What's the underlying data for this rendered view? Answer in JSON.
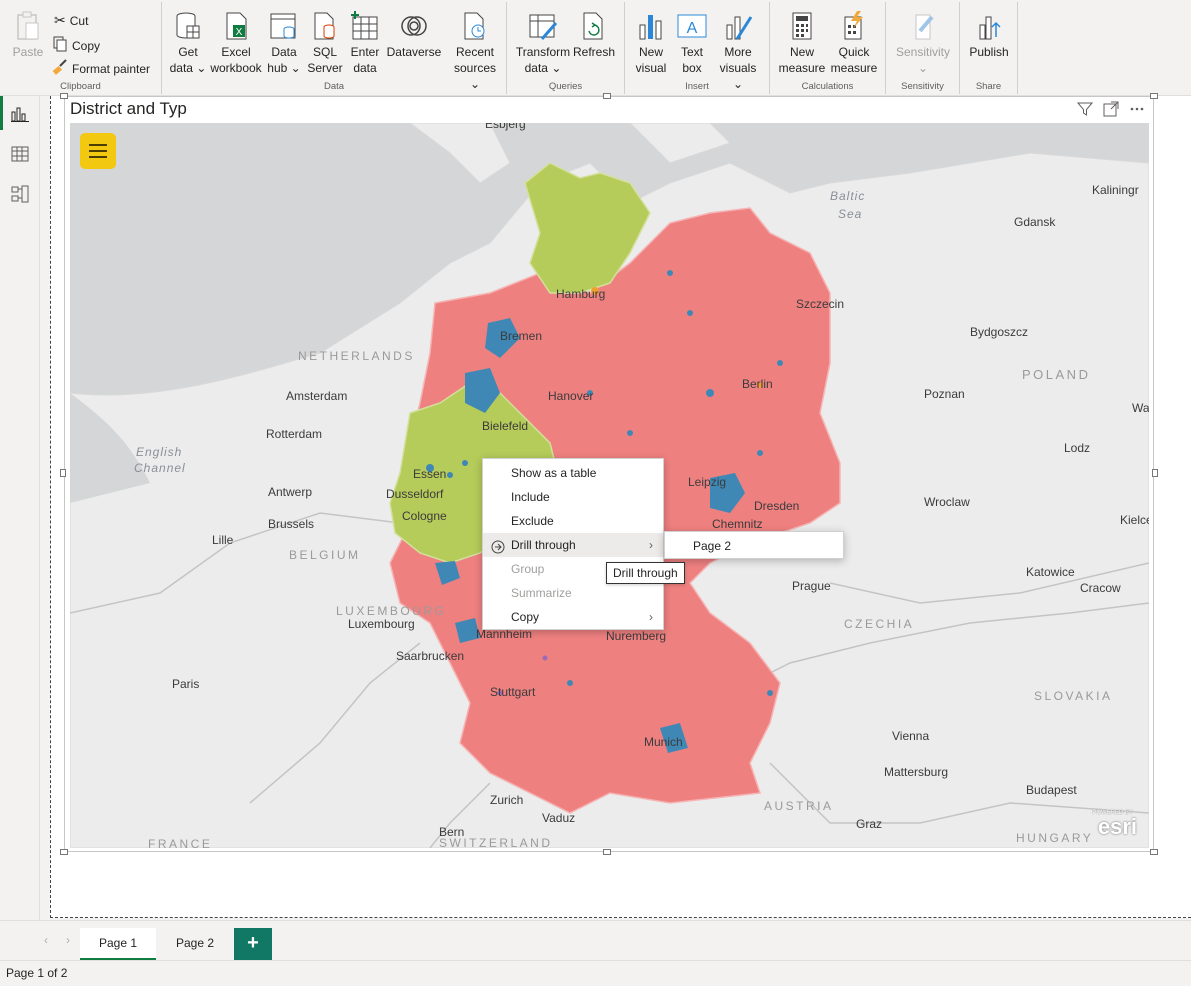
{
  "ribbon": {
    "clipboard": {
      "paste": "Paste",
      "cut": "Cut",
      "copy": "Copy",
      "format_painter": "Format painter",
      "label": "Clipboard"
    },
    "data": {
      "label": "Data",
      "buttons": [
        {
          "line1": "Get",
          "line2": "data ⌄"
        },
        {
          "line1": "Excel",
          "line2": "workbook"
        },
        {
          "line1": "Data",
          "line2": "hub ⌄"
        },
        {
          "line1": "SQL",
          "line2": "Server"
        },
        {
          "line1": "Enter",
          "line2": "data"
        },
        {
          "line1": "Dataverse",
          "line2": ""
        },
        {
          "line1": "Recent",
          "line2": "sources ⌄"
        }
      ]
    },
    "queries": {
      "label": "Queries",
      "transform_1": "Transform",
      "transform_2": "data ⌄",
      "refresh": "Refresh"
    },
    "insert": {
      "label": "Insert",
      "new_visual_1": "New",
      "new_visual_2": "visual",
      "text_box_1": "Text",
      "text_box_2": "box",
      "more_1": "More",
      "more_2": "visuals ⌄"
    },
    "calculations": {
      "label": "Calculations",
      "new_measure_1": "New",
      "new_measure_2": "measure",
      "quick_measure_1": "Quick",
      "quick_measure_2": "measure"
    },
    "sensitivity": {
      "label": "Sensitivity",
      "button": "Sensitivity",
      "arrow": "⌄"
    },
    "share": {
      "label": "Share",
      "publish": "Publish"
    }
  },
  "visual": {
    "title": "District and Typ",
    "map_labels": {
      "cities": [
        "Esbjerg",
        "Kaliningr",
        "Gdansk",
        "Hamburg",
        "Szczecin",
        "Bremen",
        "Bydgoszcz",
        "Berlin",
        "Amsterdam",
        "Hanover",
        "Poznan",
        "Wa",
        "Rotterdam",
        "Bielefeld",
        "Lodz",
        "Essen",
        "Leipzig",
        "Antwerp",
        "Dusseldorf",
        "Wroclaw",
        "Brussels",
        "Cologne",
        "Dresden",
        "Kielce",
        "Lille",
        "Chemnitz",
        "Prague",
        "Katowice",
        "Cracow",
        "Luxembourg",
        "Mannheim",
        "Nuremberg",
        "Saarbrucken",
        "Paris",
        "Stuttgart",
        "Vienna",
        "Munich",
        "Mattersburg",
        "Budapest",
        "Zurich",
        "Vaduz",
        "Graz",
        "Bern"
      ],
      "countries": [
        "NETHERLANDS",
        "POLAND",
        "BELGIUM",
        "LUXEMBOURG",
        "CZECHIA",
        "SLOVAKIA",
        "AUSTRIA",
        "FRANCE",
        "SWITZERLAND",
        "HUNGARY"
      ],
      "water": [
        "Baltic",
        "Sea",
        "English",
        "Channel"
      ]
    },
    "esri": "esri",
    "esri_powered": "POWERED BY",
    "colors": {
      "red": "#ef8080",
      "green": "#b5cc5a",
      "blue": "#3f88b6",
      "orange": "#f0a030"
    }
  },
  "context_menu": {
    "items": [
      {
        "label": "Show as a table",
        "disabled": false
      },
      {
        "label": "Include",
        "disabled": false
      },
      {
        "label": "Exclude",
        "disabled": false
      },
      {
        "label": "Drill through",
        "disabled": false
      },
      {
        "label": "Group",
        "disabled": true
      },
      {
        "label": "Summarize",
        "disabled": true
      },
      {
        "label": "Copy",
        "disabled": false
      }
    ],
    "submenu_item": "Page 2",
    "tooltip": "Drill through"
  },
  "tabs": {
    "page1": "Page 1",
    "page2": "Page 2",
    "add": "+"
  },
  "status": "Page 1 of 2"
}
